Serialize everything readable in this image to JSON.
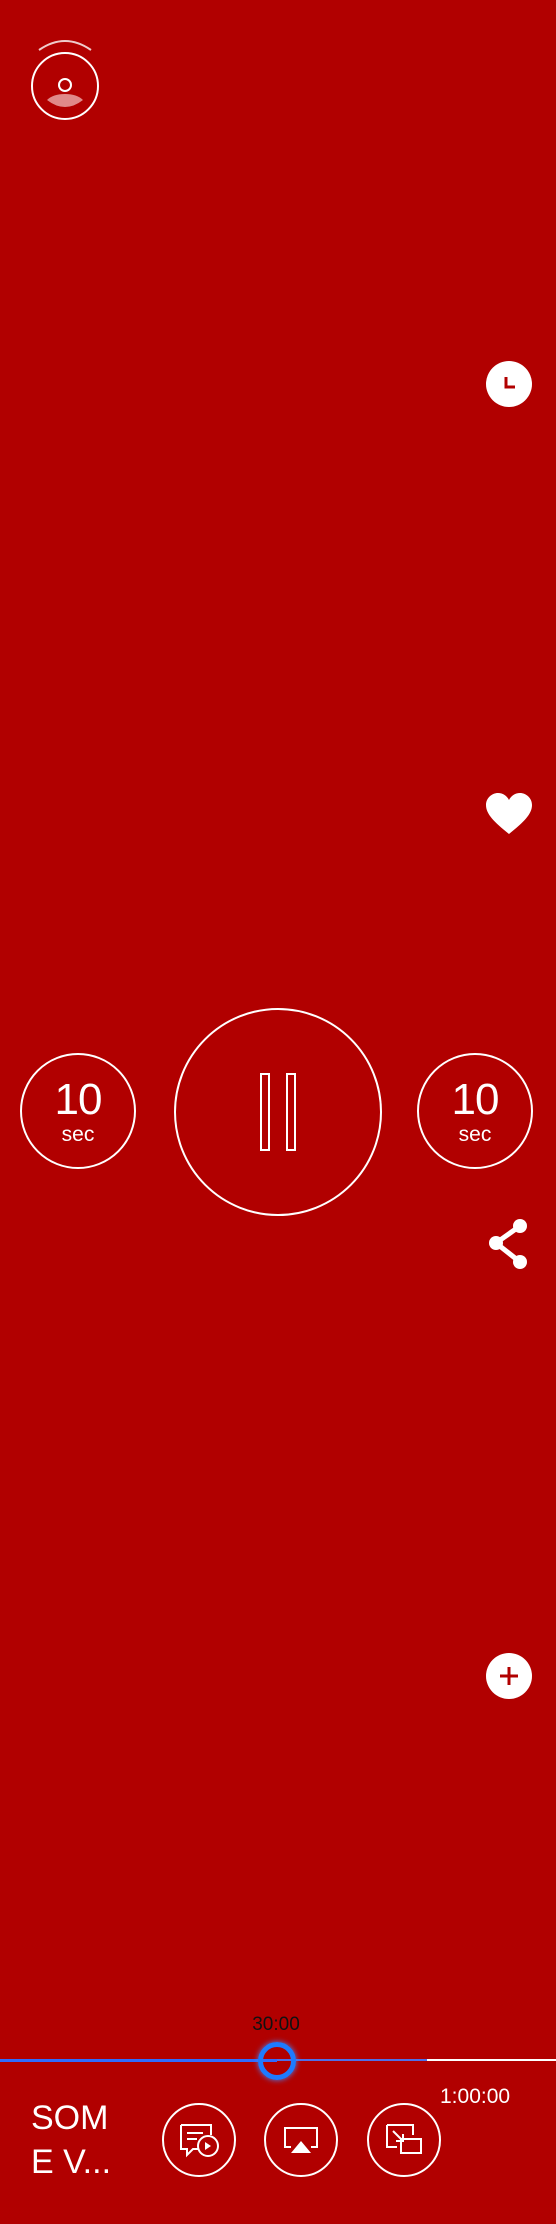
{
  "player": {
    "current_time": "30:00",
    "total_time": "1:00:00",
    "progress": 0.5,
    "title": "SOM\nE V...",
    "skip_back": {
      "number": "10",
      "unit": "sec"
    },
    "skip_forward": {
      "number": "10",
      "unit": "sec"
    }
  },
  "colors": {
    "background": "#b10000",
    "progress_played": "#2f6bff",
    "thumb": "#1e7bff",
    "foreground": "#ffffff"
  },
  "icons": [
    "cast-icon",
    "clock-icon",
    "heart-icon",
    "share-icon",
    "plus-icon",
    "pause-icon",
    "caption-audio-icon",
    "airplay-icon",
    "picture-in-picture-icon"
  ]
}
